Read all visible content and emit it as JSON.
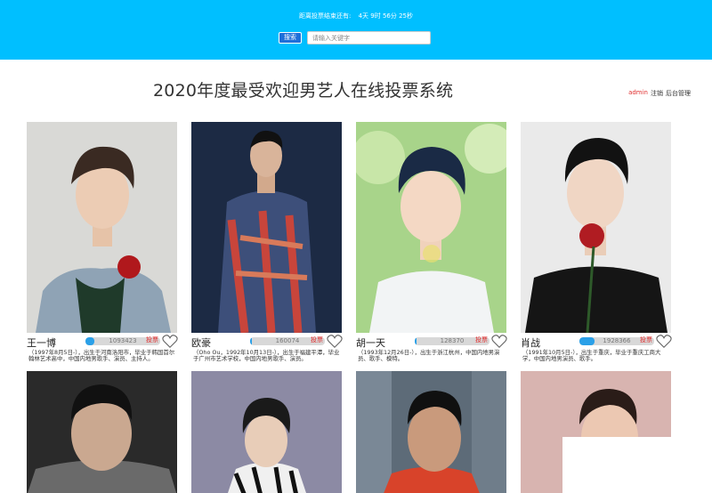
{
  "header": {
    "countdown_label": "距离投票结束还有:",
    "countdown_value": "4天 9时 56分 25秒",
    "search_button": "搜索",
    "search_placeholder": "请输入关键字"
  },
  "page_title": "2020年度最受欢迎男艺人在线投票系统",
  "userbar": {
    "user": "admin",
    "logout": "注销",
    "admin_panel": "后台管理"
  },
  "vote_label": "投票",
  "colors": {
    "header_bg": "#00bfff",
    "progress_fill": "#2aa0e8",
    "vote_red": "#e02020"
  },
  "candidates": [
    {
      "name": "王一博",
      "votes": "1093423",
      "progress": 0.12,
      "bio": "（1997年8月5日-），出生于河南洛阳市，毕业于韩国首尔翰林艺术高中，中国内地男歌手、演员、主持人。"
    },
    {
      "name": "欧豪",
      "votes": "160074",
      "progress": 0.02,
      "bio": "（Oho Ou，1992年10月13日-），出生于福建平潭，毕业于广州市艺术学校，中国内地男歌手、演员。"
    },
    {
      "name": "胡一天",
      "votes": "128370",
      "progress": 0.02,
      "bio": "（1993年12月26日-），出生于浙江杭州，中国内地男演员、歌手、模特。"
    },
    {
      "name": "肖战",
      "votes": "1928366",
      "progress": 0.2,
      "bio": "（1991年10月5日-），出生于重庆，毕业于重庆工商大学，中国内地男演员、歌手。"
    }
  ]
}
